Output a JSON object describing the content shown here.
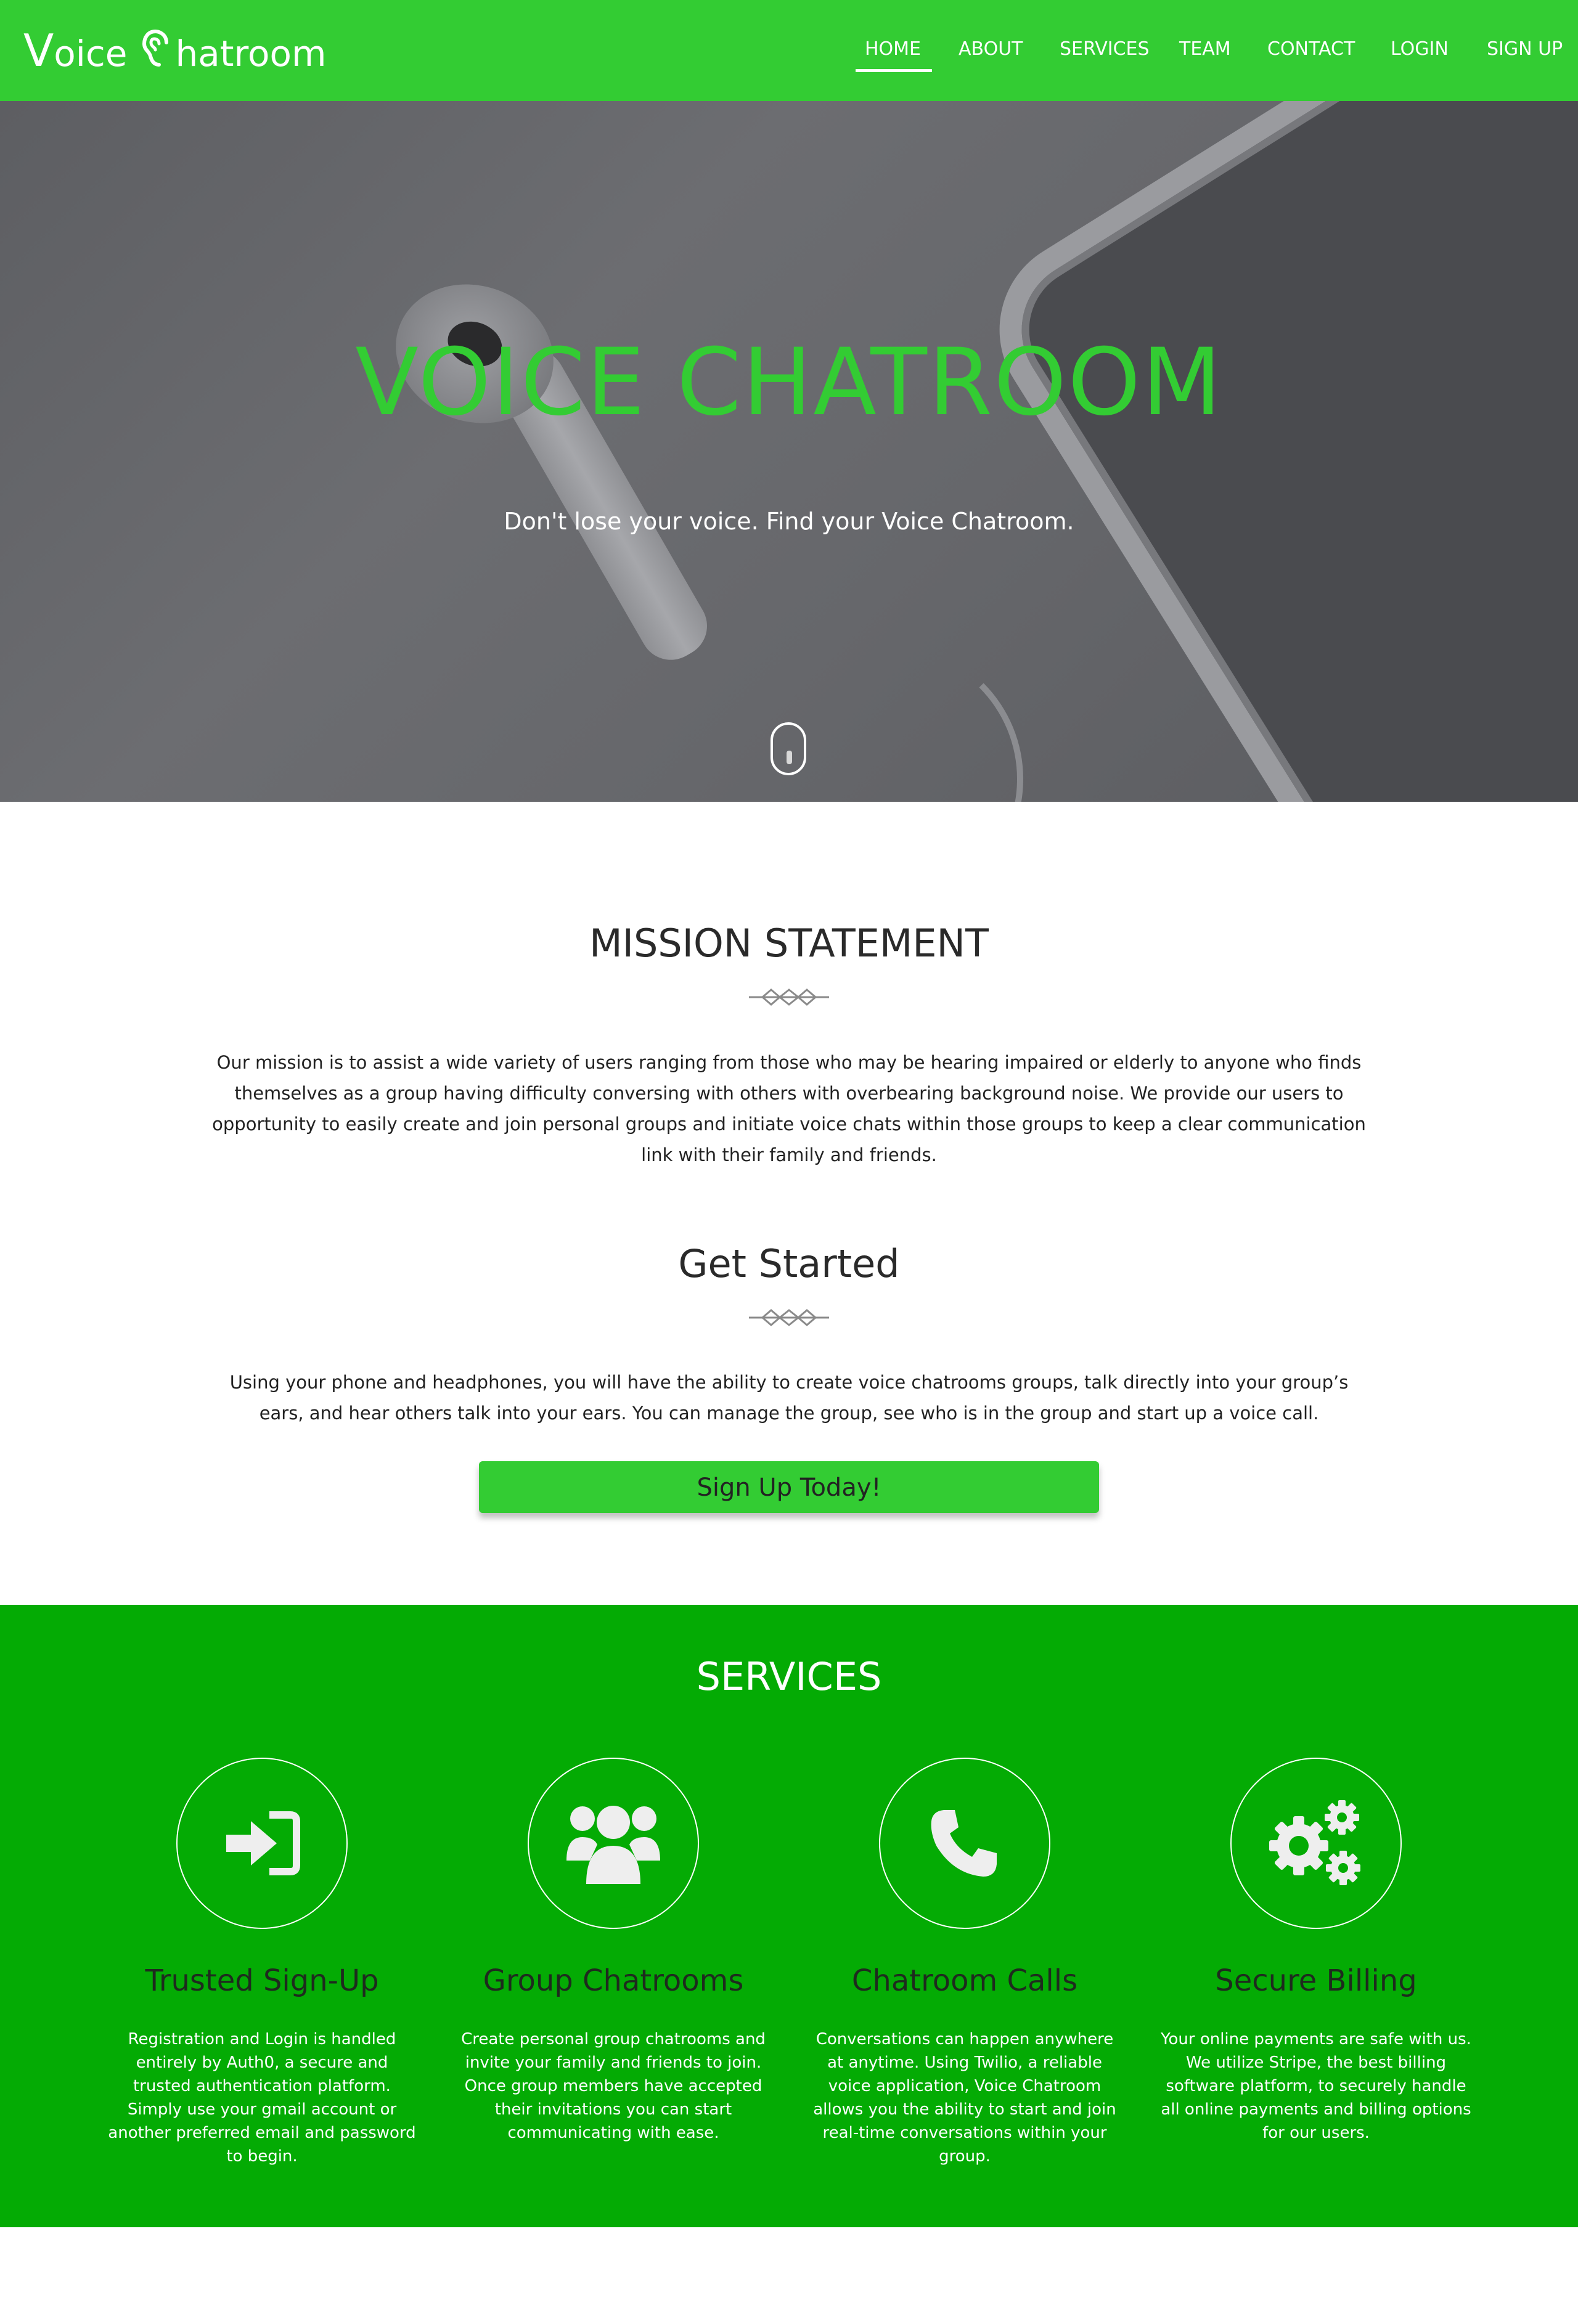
{
  "nav": {
    "brand": {
      "first_letter": "V",
      "first_rest": "oice",
      "second_rest": "hatroom"
    },
    "links": [
      "HOME",
      "ABOUT",
      "SERVICES",
      "TEAM",
      "CONTACT",
      "LOGIN",
      "SIGN UP"
    ],
    "active": "HOME"
  },
  "hero": {
    "title": "VOICE CHATROOM",
    "subtitle": "Don't lose your voice. Find your Voice Chatroom."
  },
  "mission": {
    "title": "MISSION STATEMENT",
    "text": "Our mission is to assist a wide variety of users ranging from those who may be hearing impaired or elderly to anyone who finds themselves as a group having difficulty conversing with others with overbearing background noise. We provide our users to opportunity to easily create and join personal groups and initiate voice chats within those groups to keep a clear communication link with their family and friends."
  },
  "get_started": {
    "title": "Get Started",
    "text": "Using your phone and headphones, you will have the ability to create voice chatrooms groups, talk directly into your group’s ears, and hear others talk into your ears. You can manage the group, see who is in the group and start up a voice call.",
    "button": "Sign Up Today!"
  },
  "services": {
    "title": "SERVICES",
    "items": [
      {
        "icon": "sign-in-icon",
        "name": "Trusted Sign-Up",
        "desc": "Registration and Login is handled entirely by Auth0, a secure and trusted authentication platform. Simply use your gmail account or another preferred email and password to begin."
      },
      {
        "icon": "users-icon",
        "name": "Group Chatrooms",
        "desc": "Create personal group chatrooms and invite your family and friends to join. Once group members have accepted their invitations you can start communicating with ease."
      },
      {
        "icon": "phone-icon",
        "name": "Chatroom Calls",
        "desc": "Conversations can happen anywhere at anytime. Using Twilio, a reliable voice application, Voice Chatroom allows you the ability to start and join real-time conversations within your group."
      },
      {
        "icon": "gears-icon",
        "name": "Secure Billing",
        "desc": "Your online payments are safe with us. We utilize Stripe, the best billing software platform, to securely handle all online payments and billing options for our users."
      }
    ]
  },
  "colors": {
    "brand_green": "#33cc33",
    "services_green": "#04ab04",
    "hero_gray": "#646569"
  }
}
